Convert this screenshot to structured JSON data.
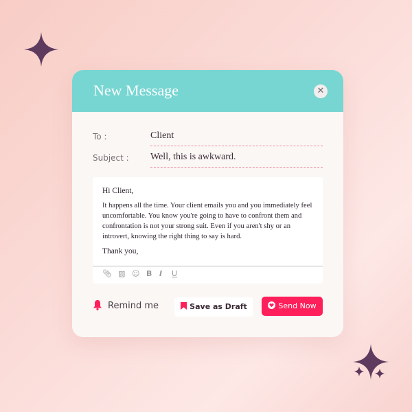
{
  "compose": {
    "title": "New Message",
    "to_label": "To :",
    "to_value": "Client",
    "subject_label": "Subject :",
    "subject_value": "Well, this is awkward.",
    "body": {
      "greeting": "Hi Client,",
      "lines": [
        "It happens all the time. Your client emails you and you immediately feel",
        "uncomfortable. You know you're going to have to confront them and",
        "confrontation is not your strong suit. Even if you aren't shy or an",
        "introvert, knowing the right thing to say is hard."
      ],
      "closing": "Thank you,"
    },
    "toolbar": [
      "attach-icon",
      "image-icon",
      "emoji-icon",
      "B",
      "I",
      "U"
    ],
    "remind_label": "Remind me",
    "draft_label": "Save as Draft",
    "send_label": "Send Now"
  },
  "colors": {
    "header": "#77d6d2",
    "accent": "#ff1f5a",
    "sparkle": "#5e3a5e"
  }
}
